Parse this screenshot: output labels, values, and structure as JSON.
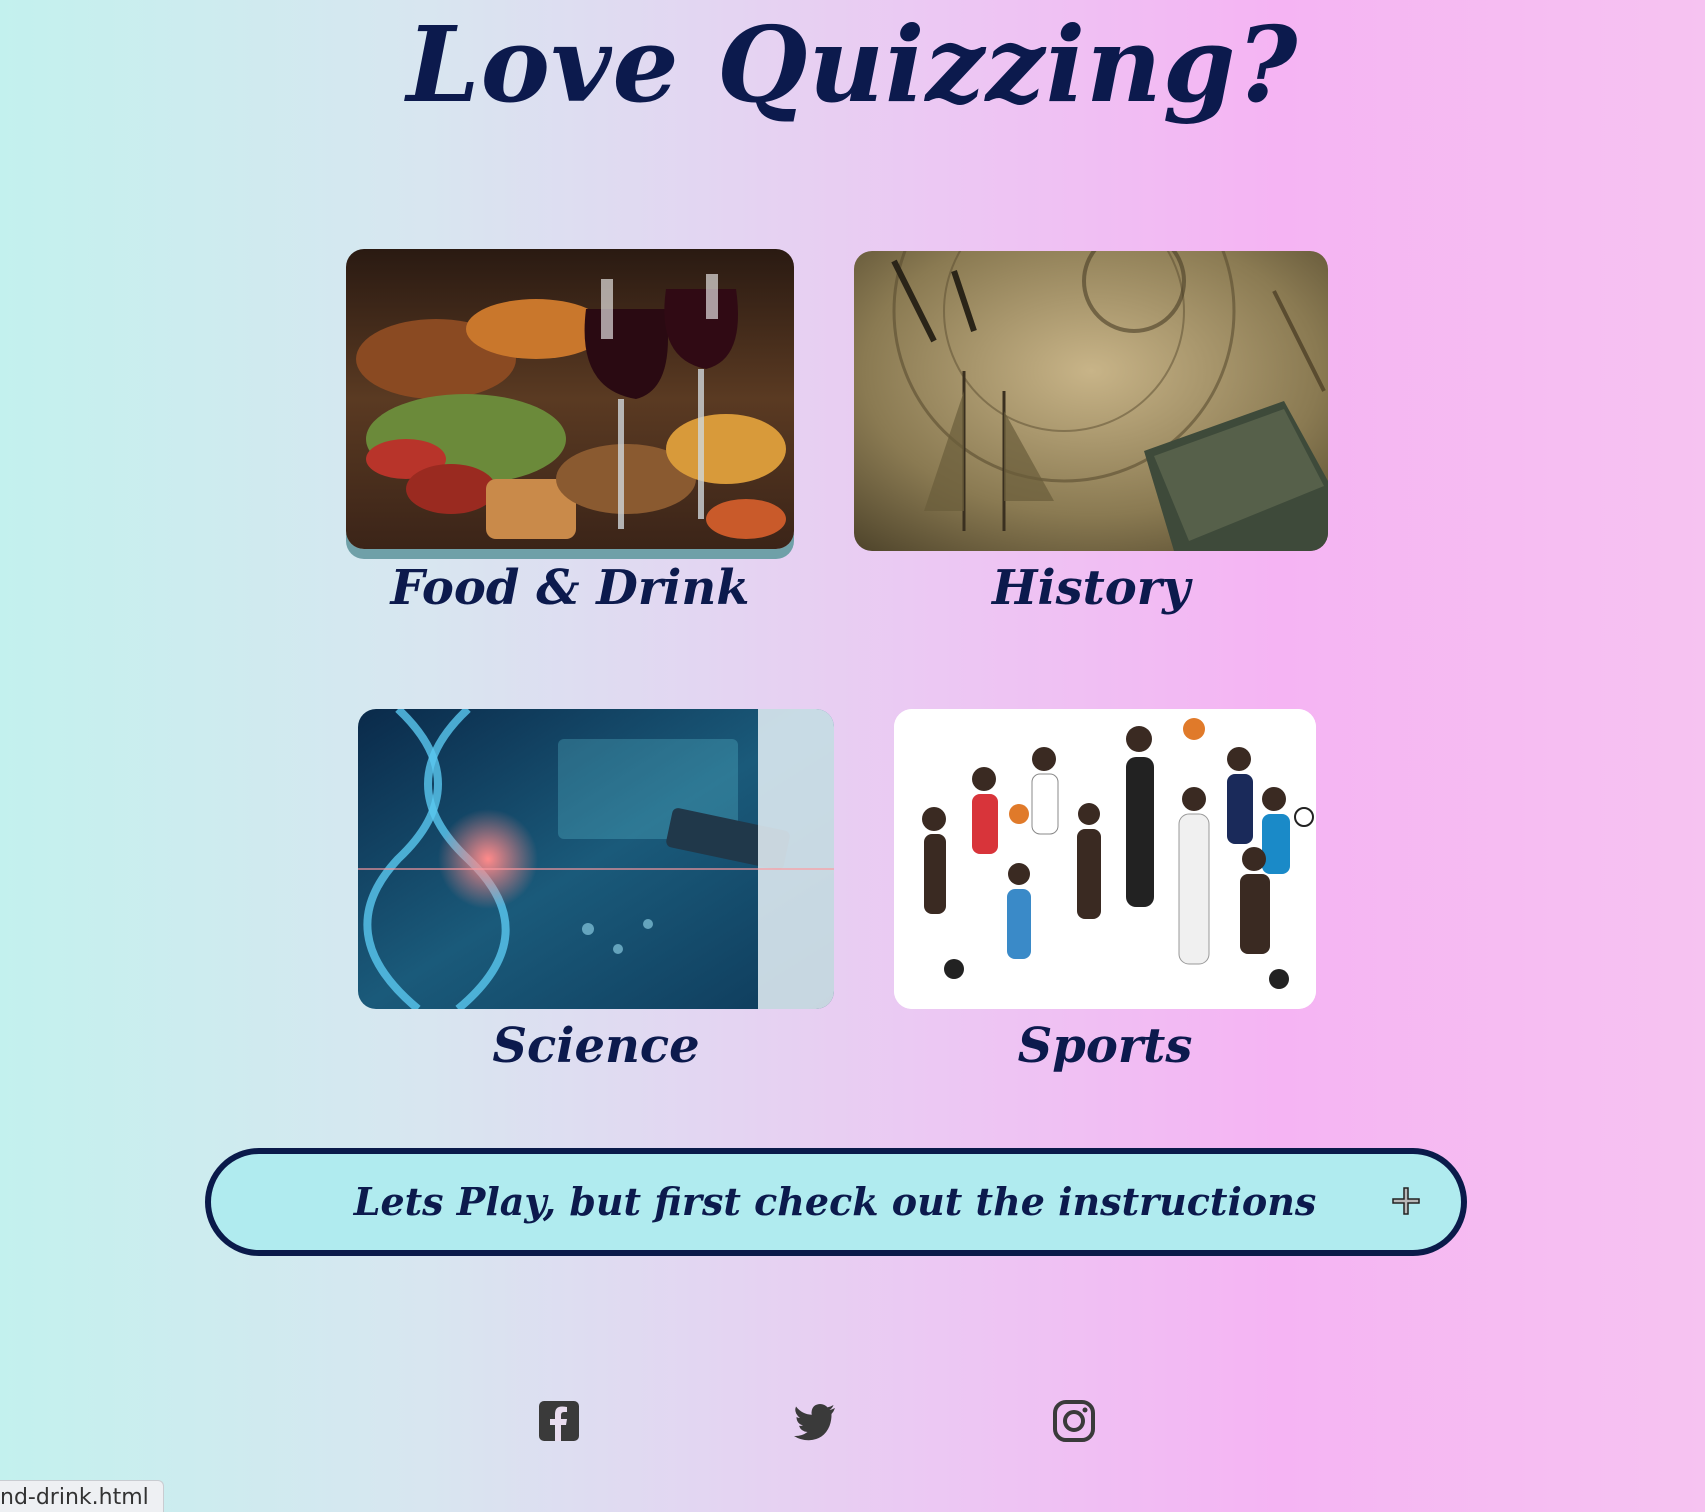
{
  "page": {
    "title": "Love Quizzing?"
  },
  "categories": [
    {
      "label": "Food & Drink",
      "image": "food-and-wine-photo"
    },
    {
      "label": "History",
      "image": "history-collage-photo"
    },
    {
      "label": "Science",
      "image": "dna-science-photo"
    },
    {
      "label": "Sports",
      "image": "athletes-group-photo"
    }
  ],
  "instructions": {
    "label": "Lets Play, but first check out the instructions",
    "icon": "plus-icon"
  },
  "footer": {
    "social": [
      {
        "icon": "facebook-icon"
      },
      {
        "icon": "twitter-icon"
      },
      {
        "icon": "instagram-icon"
      }
    ]
  },
  "status_bar": {
    "url": "nd-drink.html"
  },
  "colors": {
    "heading": "#0c1a4d",
    "accordion_bg": "#b0ebef",
    "accordion_border": "#0a1a4a",
    "gradient_left": "#c3f1ee",
    "gradient_right": "#f5b4f3"
  }
}
